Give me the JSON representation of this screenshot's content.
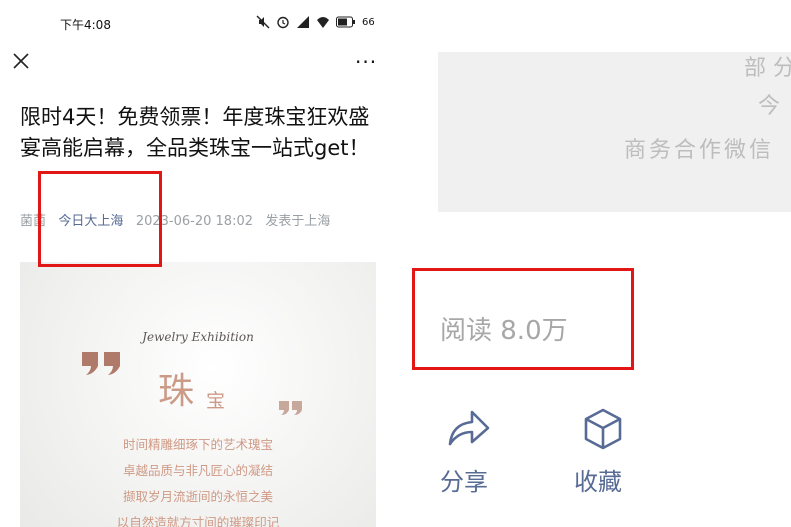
{
  "status_bar": {
    "time": "下午4:08",
    "battery": "66"
  },
  "nav": {
    "more_label": "···"
  },
  "article": {
    "title": "限时4天！免费领票！年度珠宝狂欢盛宴高能启幕，全品类珠宝一站式get！",
    "author": "菌菌",
    "account": "今日大上海",
    "date": "2023-06-20 18:02",
    "location": "发表于上海"
  },
  "hero": {
    "subtitle": "Jewelry Exhibition",
    "big_char": "珠",
    "small_char": "宝",
    "lines": [
      "时间精雕细琢下的艺术瑰宝",
      "卓越品质与非凡匠心的凝结",
      "撷取岁月流逝间的永恒之美",
      "以自然造就方寸间的璀璨印记"
    ]
  },
  "right_panel": {
    "gray_lines": [
      "部 分",
      "今",
      "商务合作微信"
    ],
    "read_count": "阅读 8.0万",
    "share_label": "分享",
    "favorite_label": "收藏"
  },
  "colors": {
    "accent_link": "#576b95",
    "annotation_red": "#e31616",
    "hero_pink": "#cc9b88"
  }
}
